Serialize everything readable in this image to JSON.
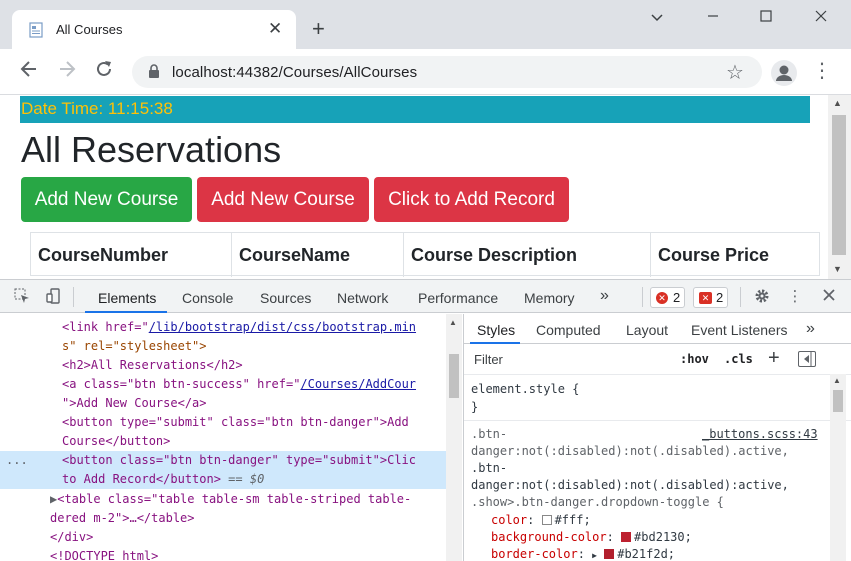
{
  "browser": {
    "tab_title": "All Courses",
    "url": "localhost:44382/Courses/AllCourses",
    "new_tab": "+",
    "close_tab": "✕"
  },
  "page": {
    "date_time": "Date Time: 11:15:38",
    "heading": "All Reservations",
    "buttons": [
      "Add New Course",
      "Add New Course",
      "Click to Add Record"
    ],
    "table_headers": [
      "CourseNumber",
      "CourseName",
      "Course Description",
      "Course Price"
    ]
  },
  "devtools": {
    "tabs": [
      "Elements",
      "Console",
      "Sources",
      "Network",
      "Performance",
      "Memory"
    ],
    "more": "»",
    "errors_count": "2",
    "issues_count": "2",
    "styles_tabs": [
      "Styles",
      "Computed",
      "Layout",
      "Event Listeners"
    ],
    "filter_placeholder": "Filter",
    "hov": ":hov",
    "cls": ".cls",
    "element_style": "element.style {",
    "close_brace": "}",
    "source_link": "_buttons.scss:43",
    "selector_lines": [
      ".btn-",
      "danger:not(:disabled):not(.disabled).active,",
      ".btn-",
      "danger:not(:disabled):not(.disabled):active,",
      ".show>.btn-danger.dropdown-toggle {"
    ],
    "declarations": [
      {
        "prop": "color",
        "value": "#fff",
        "swatch": "#ffffff"
      },
      {
        "prop": "background-color",
        "value": "#bd2130",
        "swatch": "#bd2130"
      },
      {
        "prop": "border-color",
        "value": "#b21f2d",
        "swatch": "#b21f2d"
      }
    ]
  },
  "elements_code": {
    "l1_open": "<link href=\"",
    "l1_link": "/lib/bootstrap/dist/css/bootstrap.min",
    "l2": "s\" rel=\"stylesheet\">",
    "l3": "<h2>All Reservations</h2>",
    "l4_a": "<a class=\"btn btn-success\" href=\"",
    "l4_link": "/Courses/AddCour",
    "l5": "\">Add New Course</a>",
    "l6": "<button type=\"submit\" class=\"btn btn-danger\">Add ",
    "l7": "Course</button>",
    "l8": "<button class=\"btn btn-danger\" type=\"submit\">Clic",
    "l9_a": "to Add Record</button>",
    "l9_b": " == $0",
    "l10": "<table class=\"table table-sm table-striped table-",
    "l11": "dered m-2\">…</table>",
    "l12": "</div>",
    "l13": "<!DOCTYPE html>",
    "dots": "..."
  },
  "colors": {
    "success": "#28a745",
    "danger": "#dc3545",
    "info": "#17a2b8",
    "warning": "#ffc107",
    "devtools_accent": "#1a73e8"
  }
}
